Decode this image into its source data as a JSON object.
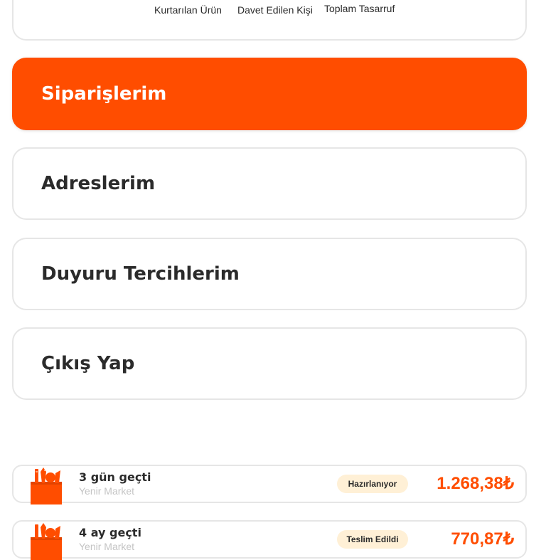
{
  "stats": {
    "items": [
      {
        "label": "Kurtarılan Ürün"
      },
      {
        "label": "Davet Edilen Kişi"
      },
      {
        "label": "Toplam Tasarruf"
      }
    ]
  },
  "menu": {
    "items": [
      {
        "label": "Siparişlerim",
        "active": true
      },
      {
        "label": "Adreslerim",
        "active": false
      },
      {
        "label": "Duyuru Tercihlerim",
        "active": false
      },
      {
        "label": "Çıkış Yap",
        "active": false
      }
    ]
  },
  "orders": [
    {
      "time": "3 gün geçti",
      "store": "Yenir Market",
      "status": "Hazırlanıyor",
      "price": "1.268,38₺",
      "icon": "grocery-bag-icon"
    },
    {
      "time": "4 ay geçti",
      "store": "Yenir Market",
      "status": "Teslim Edildi",
      "price": "770,87₺",
      "icon": "grocery-bag-icon"
    }
  ],
  "colors": {
    "accent": "#ff4d00",
    "badge_bg": "#fff0d6",
    "border": "#e6e6e6"
  }
}
